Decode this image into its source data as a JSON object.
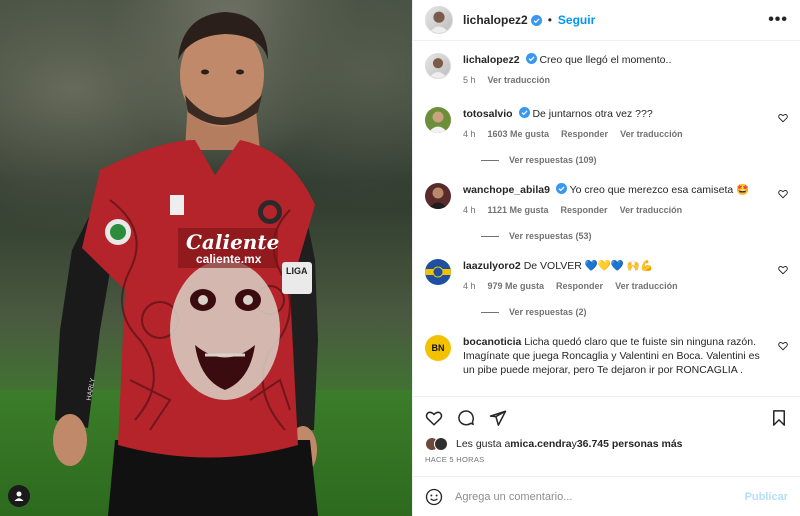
{
  "post": {
    "username": "lichalopez2",
    "follow_label": "Seguir",
    "caption": "Creo que llegó el momento..",
    "caption_time": "5 h",
    "caption_translate": "Ver traducción",
    "more_label": "•••"
  },
  "comments": [
    {
      "username": "totosalvio",
      "verified": true,
      "text": "De juntarnos otra vez ???",
      "time": "4 h",
      "likes": "1603 Me gusta",
      "reply": "Responder",
      "translate": "Ver traducción",
      "replies": "Ver respuestas (109)",
      "avatar_color": "#6b8f3a"
    },
    {
      "username": "wanchope_abila9",
      "verified": true,
      "text": "Yo creo que merezco esa camiseta 🤩",
      "time": "4 h",
      "likes": "1121 Me gusta",
      "reply": "Responder",
      "translate": "Ver traducción",
      "replies": "Ver respuestas (53)",
      "avatar_color": "#5a2b2b"
    },
    {
      "username": "laazulyoro2",
      "verified": false,
      "text": "De VOLVER 💙💛💙 🙌💪",
      "time": "4 h",
      "likes": "979 Me gusta",
      "reply": "Responder",
      "translate": "Ver traducción",
      "replies": "Ver respuestas (2)",
      "avatar_color": "#1f4fa0"
    },
    {
      "username": "bocanoticia",
      "verified": false,
      "text": "Licha quedó claro que te fuiste sin ninguna razón. Imagínate que juega Roncaglia y Valentini en Boca. Valentini es un pibe puede mejorar, pero Te dejaron ir por RONCAGLIA .",
      "avatar_text": "BN",
      "avatar_color": "#f2c200"
    }
  ],
  "likes_line": {
    "prefix": "Les gusta a ",
    "user": "mica.cendra",
    "middle": " y ",
    "count": "36.745 personas más"
  },
  "time_ago": "HACE 5 HORAS",
  "comment_box": {
    "placeholder": "Agrega un comentario...",
    "publish": "Publicar"
  },
  "jersey": {
    "brand": "Caliente",
    "sub": "caliente.mx",
    "liga": "LIGA",
    "sleeve": "HARLY"
  },
  "colors": {
    "accent": "#0095f6",
    "verified": "#3897f0",
    "jersey": "#b5232b"
  }
}
